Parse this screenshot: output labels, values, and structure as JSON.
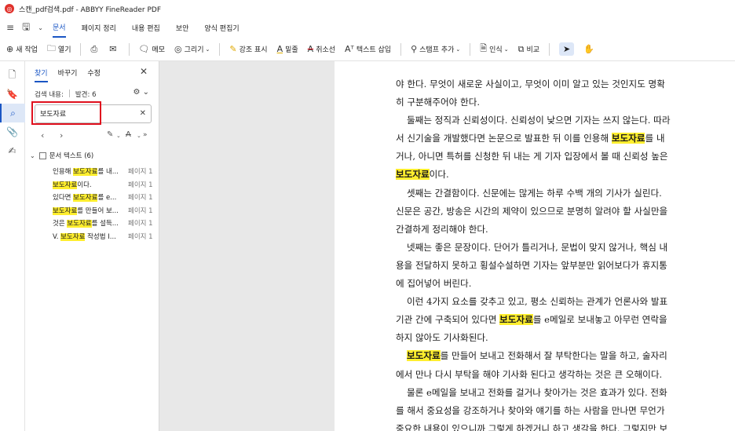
{
  "window": {
    "title": "스캔_pdf검색.pdf - ABBYY FineReader PDF",
    "logo_glyph": "◎"
  },
  "menu": {
    "tabs": [
      "문서",
      "페이지 정리",
      "내용 편집",
      "보안",
      "양식 편집기"
    ],
    "active": 0
  },
  "toolbar": {
    "new_task": "새 작업",
    "open": "열기",
    "note": "메모",
    "draw": "그리기",
    "highlight": "강조 표시",
    "underline": "밑줄",
    "strikeout": "취소선",
    "insert_text": "텍스트 삽입",
    "add_stamp": "스탬프 추가",
    "recognize": "인식",
    "compare": "비교"
  },
  "panel": {
    "tabs": [
      "찾기",
      "바꾸기",
      "수정"
    ],
    "result_label": "검색 내용:",
    "found_label": "발견: 6",
    "search_value": "보도자료",
    "root_label": "문서 텍스트 (6)",
    "results": [
      {
        "pre": "인용해 ",
        "hit": "보도자료",
        "post": "를 내...",
        "page": "페이지 1"
      },
      {
        "pre": "",
        "hit": "보도자료",
        "post": "이다.",
        "page": "페이지 1"
      },
      {
        "pre": "있다면 ",
        "hit": "보도자료",
        "post": "를 e...",
        "page": "페이지 1"
      },
      {
        "pre": "",
        "hit": "보도자료",
        "post": "를 만들어 보...",
        "page": "페이지 1"
      },
      {
        "pre": "것은 ",
        "hit": "보도자료",
        "post": "를 설득...",
        "page": "페이지 1"
      },
      {
        "pre": "V. ",
        "hit": "보도자료",
        "post": " 작성법 I...",
        "page": "페이지 1"
      }
    ]
  },
  "document": {
    "lines": [
      {
        "indent": false,
        "parts": [
          "야 한다. 무엇이 새로운 사실이고, 무엇이 이미 알고 있는 것인지도 명확"
        ]
      },
      {
        "indent": false,
        "parts": [
          "히 구분해주어야 한다."
        ]
      },
      {
        "indent": true,
        "parts": [
          "둘째는 정직과 신뢰성이다. 신뢰성이 낮으면 기자는 쓰지 않는다. 따라"
        ]
      },
      {
        "indent": false,
        "parts": [
          "서 신기술을 개발했다면 논문으로 발표한 뒤 이를 인용해 ",
          "보도자료",
          "를 내"
        ]
      },
      {
        "indent": false,
        "parts": [
          "거나, 아니면 특허를 신청한 뒤 내는 게 기자 입장에서 볼 때 신뢰성 높은"
        ]
      },
      {
        "indent": false,
        "parts": [
          "",
          "보도자료",
          "이다."
        ]
      },
      {
        "indent": true,
        "parts": [
          "셋째는 간결함이다. 신문에는 많게는 하루 수백 개의 기사가 실린다."
        ]
      },
      {
        "indent": false,
        "parts": [
          "신문은 공간, 방송은 시간의 제약이 있으므로 분명히 알려야 할 사실만을"
        ]
      },
      {
        "indent": false,
        "parts": [
          "간결하게 정리해야 한다."
        ]
      },
      {
        "indent": true,
        "parts": [
          "넷째는 좋은 문장이다. 단어가 틀리거나, 문법이 맞지 않거나, 핵심 내"
        ]
      },
      {
        "indent": false,
        "parts": [
          "용을 전달하지 못하고 횡설수설하면 기자는 앞부분만 읽어보다가 휴지통"
        ]
      },
      {
        "indent": false,
        "parts": [
          "에 집어넣어 버린다."
        ]
      },
      {
        "indent": true,
        "parts": [
          "이런 4가지 요소를 갖추고 있고, 평소 신뢰하는 관계가 언론사와 발표"
        ]
      },
      {
        "indent": false,
        "parts": [
          "기관 간에 구축되어 있다면 ",
          "보도자료",
          "를 e메일로 보내놓고 아무런 연락을"
        ]
      },
      {
        "indent": false,
        "parts": [
          "하지 않아도 기사화된다."
        ]
      },
      {
        "indent": true,
        "parts": [
          "",
          "보도자료",
          "를 만들어 보내고 전화해서 잘 부탁한다는 말을 하고, 술자리"
        ]
      },
      {
        "indent": false,
        "parts": [
          "에서 만나 다시 부탁을 해야 기사화 된다고 생각하는 것은 큰 오해이다."
        ]
      },
      {
        "indent": true,
        "parts": [
          "물론 e메일을 보내고 전화를 걸거나 찾아가는 것은 효과가 있다. 전화"
        ]
      },
      {
        "indent": false,
        "parts": [
          "를 해서 중요성을 강조하거나 찾아와 얘기를 하는 사람을 만나면 무언가"
        ]
      },
      {
        "indent": false,
        "parts": [
          "중요한 내용이 있으니까 그렇게 하겠거니 하고 생각을 한다. 그렇지만 보"
        ]
      }
    ]
  },
  "colors": {
    "accent": "#1a56c4",
    "highlight": "#ffee2e",
    "red_box": "#e0101e"
  }
}
